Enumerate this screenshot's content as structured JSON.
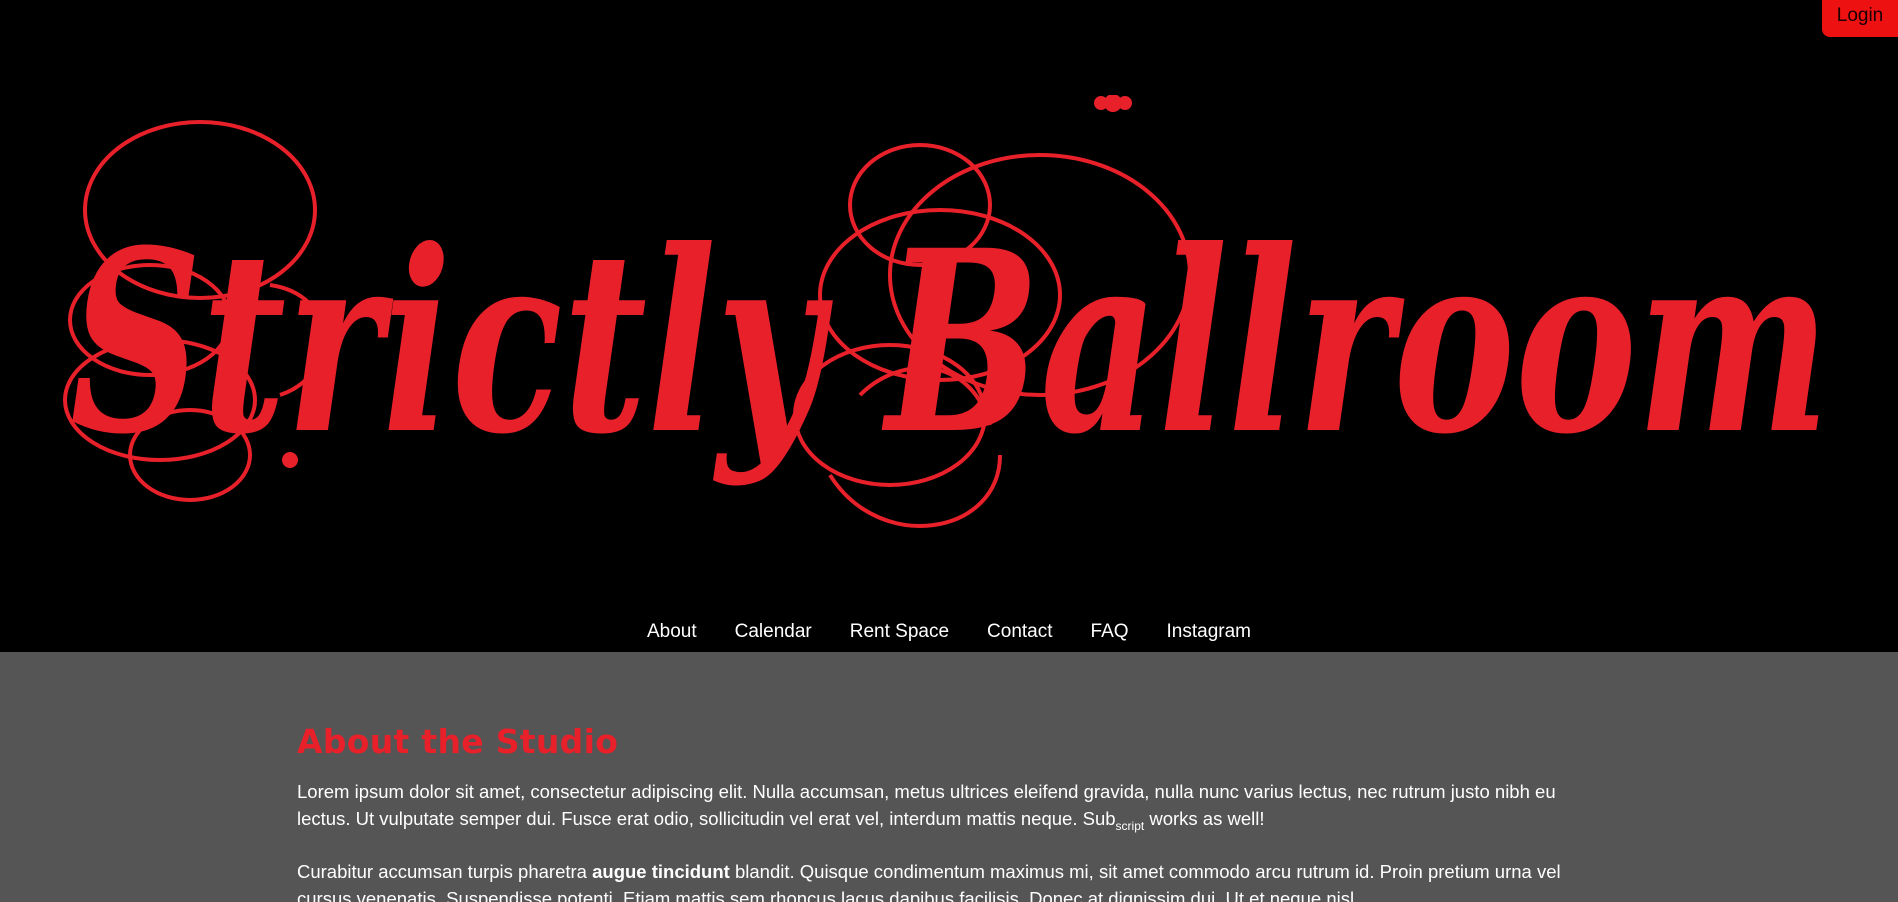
{
  "header": {
    "login_label": "Login",
    "logo_text": "Strictly Ballroom",
    "brand_color": "#e8202a"
  },
  "nav": {
    "items": [
      {
        "label": "About"
      },
      {
        "label": "Calendar"
      },
      {
        "label": "Rent Space"
      },
      {
        "label": "Contact"
      },
      {
        "label": "FAQ"
      },
      {
        "label": "Instagram"
      }
    ]
  },
  "main": {
    "heading": "About the Studio",
    "paragraph1": {
      "text_before": "Lorem ipsum dolor sit amet, consectetur adipiscing elit. Nulla accumsan, metus ultrices eleifend gravida, nulla nunc varius lectus, nec rutrum justo nibh eu lectus. Ut vulputate semper dui. Fusce erat odio, sollicitudin vel erat vel, interdum mattis neque. Sub",
      "subscript": "script",
      "text_after": " works as well!"
    },
    "paragraph2": {
      "text_before": "Curabitur accumsan turpis pharetra ",
      "bold": "augue tincidunt",
      "text_after": " blandit. Quisque condimentum maximus mi, sit amet commodo arcu rutrum id. Proin pretium urna vel cursus venenatis. Suspendisse potenti. Etiam mattis sem rhoncus lacus dapibus facilisis. Donec at dignissim dui. Ut et neque nisl."
    }
  },
  "colors": {
    "header_bg": "#000000",
    "content_bg": "#555555",
    "accent": "#e8202a",
    "login_bg": "#ee1111"
  }
}
